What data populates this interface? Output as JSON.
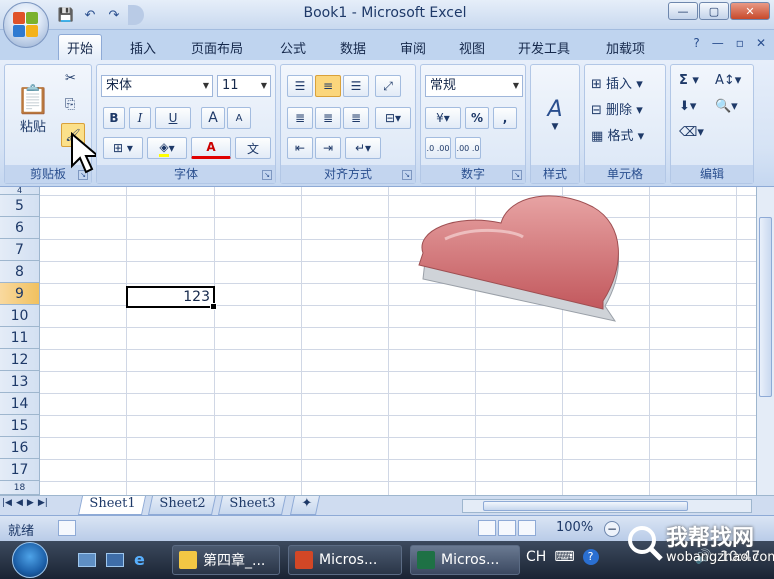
{
  "window": {
    "title": "Book1 - Microsoft Excel"
  },
  "tabs": [
    {
      "label": "开始"
    },
    {
      "label": "插入"
    },
    {
      "label": "页面布局"
    },
    {
      "label": "公式"
    },
    {
      "label": "数据"
    },
    {
      "label": "审阅"
    },
    {
      "label": "视图"
    },
    {
      "label": "开发工具"
    },
    {
      "label": "加载项"
    }
  ],
  "ribbon": {
    "clipboard": {
      "label": "剪贴板",
      "paste": "粘贴"
    },
    "font": {
      "label": "字体",
      "font_name": "宋体",
      "font_size": "11",
      "bold": "B",
      "italic": "I",
      "underline": "U",
      "grow": "A",
      "shrink": "A",
      "font_color": "A",
      "phonetic": "文"
    },
    "alignment": {
      "label": "对齐方式"
    },
    "number": {
      "label": "数字",
      "format": "常规",
      "percent": "%",
      "comma": ",",
      "inc_decimal": ".0 .00",
      "dec_decimal": ".00 .0"
    },
    "styles": {
      "label": "样式"
    },
    "cells": {
      "label": "单元格",
      "insert": "插入",
      "delete": "删除",
      "format": "格式"
    },
    "editing": {
      "label": "编辑",
      "sum": "Σ"
    }
  },
  "grid": {
    "rows": [
      "5",
      "6",
      "7",
      "8",
      "9",
      "10",
      "11",
      "12",
      "13",
      "14",
      "15",
      "16",
      "17"
    ],
    "selected_row": "9",
    "selected_value": "123"
  },
  "sheets": [
    "Sheet1",
    "Sheet2",
    "Sheet3"
  ],
  "status": {
    "mode": "就绪",
    "zoom": "100%"
  },
  "taskbar": {
    "items": [
      "第四章_...",
      "Micros...",
      "Micros..."
    ],
    "tray_lang": "CH",
    "clock": "10:47"
  },
  "watermark": {
    "text": "我帮找网",
    "sub": "wobangzhao.com"
  },
  "colors": {
    "accent": "#bfd4ef",
    "heart": "#c85a5e",
    "selection_row": "#f1c15f"
  }
}
